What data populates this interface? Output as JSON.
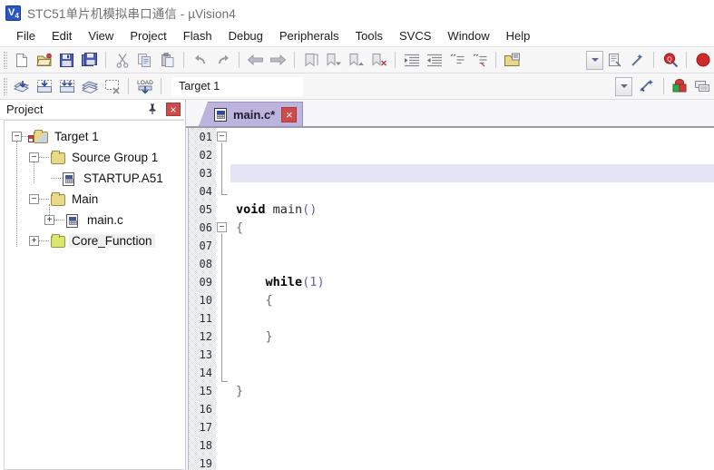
{
  "window": {
    "title": "STC51单片机模拟串口通信  - µVision4",
    "logo_label": "V4",
    "logo_icon": "uvision-logo-icon"
  },
  "menubar": {
    "items": [
      {
        "label": "File"
      },
      {
        "label": "Edit"
      },
      {
        "label": "View"
      },
      {
        "label": "Project"
      },
      {
        "label": "Flash"
      },
      {
        "label": "Debug"
      },
      {
        "label": "Peripherals"
      },
      {
        "label": "Tools"
      },
      {
        "label": "SVCS"
      },
      {
        "label": "Window"
      },
      {
        "label": "Help"
      }
    ]
  },
  "toolbar_main": {
    "buttons": [
      {
        "name": "new-file-icon",
        "tip": "New"
      },
      {
        "name": "open-file-icon",
        "tip": "Open"
      },
      {
        "name": "save-icon",
        "tip": "Save"
      },
      {
        "name": "save-all-icon",
        "tip": "Save All"
      },
      {
        "name": "cut-icon",
        "tip": "Cut"
      },
      {
        "name": "copy-icon",
        "tip": "Copy"
      },
      {
        "name": "paste-icon",
        "tip": "Paste"
      },
      {
        "name": "undo-icon",
        "tip": "Undo"
      },
      {
        "name": "redo-icon",
        "tip": "Redo"
      },
      {
        "name": "navigate-backward-icon",
        "tip": "Back"
      },
      {
        "name": "navigate-forward-icon",
        "tip": "Forward"
      },
      {
        "name": "bookmark-toggle-icon",
        "tip": "Insert/Remove Bookmark"
      },
      {
        "name": "bookmark-prev-icon",
        "tip": "Previous Bookmark"
      },
      {
        "name": "bookmark-next-icon",
        "tip": "Next Bookmark"
      },
      {
        "name": "bookmark-clear-icon",
        "tip": "Clear All Bookmarks"
      },
      {
        "name": "indent-icon",
        "tip": "Indent"
      },
      {
        "name": "outdent-icon",
        "tip": "Outdent"
      },
      {
        "name": "comment-icon",
        "tip": "Comment"
      },
      {
        "name": "uncomment-icon",
        "tip": "Uncomment"
      },
      {
        "name": "configuration-wizard-icon",
        "tip": "Configuration Wizard"
      }
    ],
    "right_buttons": [
      {
        "name": "combo-dropdown-icon",
        "tip": "Dropdown"
      },
      {
        "name": "debug-print-icon",
        "tip": "Debug"
      },
      {
        "name": "magic-wand-icon",
        "tip": "Wizard"
      },
      {
        "name": "find-in-files-icon",
        "tip": "Find in Files"
      },
      {
        "name": "stop-record-icon",
        "tip": "Stop"
      }
    ]
  },
  "toolbar_build": {
    "buttons": [
      {
        "name": "translate-icon",
        "tip": "Translate"
      },
      {
        "name": "build-target-icon",
        "tip": "Build"
      },
      {
        "name": "rebuild-all-icon",
        "tip": "Rebuild all target files"
      },
      {
        "name": "batch-build-icon",
        "tip": "Batch Build"
      },
      {
        "name": "stop-build-icon",
        "tip": "Stop Build"
      },
      {
        "name": "download-icon",
        "tip": "Download",
        "glyph": "LOAD"
      }
    ],
    "target_select": {
      "value": "Target 1",
      "name": "target-selector"
    },
    "after_buttons": [
      {
        "name": "target-options-icon",
        "tip": "Options for Target"
      },
      {
        "name": "manage-project-items-icon",
        "tip": "Manage Project Items"
      },
      {
        "name": "multi-project-icon",
        "tip": "Manage Multi-Project"
      }
    ]
  },
  "project_panel": {
    "title": "Project",
    "pin_icon": "pin-icon",
    "close_icon": "close-icon",
    "tree": [
      {
        "label": "Target 1",
        "icon": "target-folder-icon",
        "expander": "−",
        "depth": 0,
        "selected": false
      },
      {
        "label": "Source Group 1",
        "icon": "folder-icon",
        "expander": "−",
        "depth": 1,
        "selected": false
      },
      {
        "label": "STARTUP.A51",
        "icon": "source-file-icon",
        "expander": "",
        "depth": 2,
        "selected": false
      },
      {
        "label": "Main",
        "icon": "folder-icon",
        "expander": "−",
        "depth": 1,
        "selected": false
      },
      {
        "label": "main.c",
        "icon": "source-file-icon",
        "expander": "+",
        "depth": 2,
        "selected": false
      },
      {
        "label": "Core_Function",
        "icon": "folder-green-icon",
        "expander": "+",
        "depth": 1,
        "selected": true
      }
    ]
  },
  "editor": {
    "tabs": [
      {
        "label": "main.c*",
        "icon": "source-file-icon",
        "active": true,
        "close_icon": "close-icon"
      }
    ],
    "line_numbers": [
      "01",
      "02",
      "03",
      "04",
      "05",
      "06",
      "07",
      "08",
      "09",
      "10",
      "11",
      "12",
      "13",
      "14",
      "15",
      "16",
      "17",
      "18",
      "19"
    ],
    "highlighted_line": 3,
    "code_lines": [
      {
        "n": "01",
        "segments": []
      },
      {
        "n": "02",
        "segments": []
      },
      {
        "n": "03",
        "segments": []
      },
      {
        "n": "04",
        "segments": []
      },
      {
        "n": "05",
        "segments": [
          {
            "t": "void",
            "c": "kw"
          },
          {
            "t": " ",
            "c": "plain"
          },
          {
            "t": "main",
            "c": "fn"
          },
          {
            "t": "()",
            "c": "punct"
          }
        ]
      },
      {
        "n": "06",
        "segments": [
          {
            "t": "{",
            "c": "brace"
          }
        ]
      },
      {
        "n": "07",
        "segments": []
      },
      {
        "n": "08",
        "segments": []
      },
      {
        "n": "09",
        "segments": [
          {
            "t": "    ",
            "c": "plain"
          },
          {
            "t": "while",
            "c": "kw"
          },
          {
            "t": "(",
            "c": "punct"
          },
          {
            "t": "1",
            "c": "num"
          },
          {
            "t": ")",
            "c": "punct"
          }
        ]
      },
      {
        "n": "10",
        "segments": [
          {
            "t": "    {",
            "c": "brace"
          }
        ]
      },
      {
        "n": "11",
        "segments": []
      },
      {
        "n": "12",
        "segments": [
          {
            "t": "    }",
            "c": "brace"
          }
        ]
      },
      {
        "n": "13",
        "segments": []
      },
      {
        "n": "14",
        "segments": []
      },
      {
        "n": "15",
        "segments": [
          {
            "t": "}",
            "c": "brace"
          }
        ]
      },
      {
        "n": "16",
        "segments": []
      },
      {
        "n": "17",
        "segments": []
      },
      {
        "n": "18",
        "segments": []
      },
      {
        "n": "19",
        "segments": []
      }
    ]
  },
  "colors": {
    "tab_active": "#bdb4dd",
    "close_red": "#cf4a4a",
    "highlight_line": "#e4e4f5",
    "folder_yellow": "#e8d98a",
    "folder_green": "#d9e86a",
    "keyword": "#000000",
    "number": "#6b5fa8",
    "title_text": "#6f6f6f"
  }
}
